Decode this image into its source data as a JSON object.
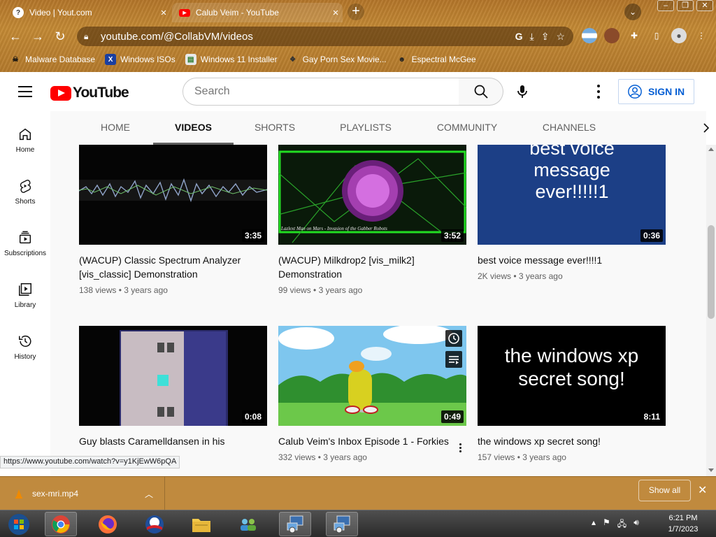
{
  "browser": {
    "tabs": [
      {
        "title": "Video | Yout.com",
        "active": false
      },
      {
        "title": "Calub Veim - YouTube",
        "active": true
      }
    ],
    "new_tab_label": "+",
    "url": "youtube.com/@CollabVM/videos",
    "bookmarks": [
      {
        "label": "Malware Database"
      },
      {
        "label": "Windows ISOs"
      },
      {
        "label": "Windows 11 Installer"
      },
      {
        "label": "Gay Porn Sex Movie..."
      },
      {
        "label": "Espectral McGee"
      }
    ],
    "status_url": "https://www.youtube.com/watch?v=y1KjEwW6pQA"
  },
  "youtube": {
    "logo_text": "YouTube",
    "search_placeholder": "Search",
    "sign_in_label": "SIGN IN",
    "channel_tabs": [
      {
        "label": "HOME"
      },
      {
        "label": "VIDEOS",
        "active": true
      },
      {
        "label": "SHORTS"
      },
      {
        "label": "PLAYLISTS"
      },
      {
        "label": "COMMUNITY"
      },
      {
        "label": "CHANNELS"
      }
    ],
    "guide": [
      {
        "label": "Home",
        "icon": "home-icon"
      },
      {
        "label": "Shorts",
        "icon": "shorts-icon"
      },
      {
        "label": "Subscriptions",
        "icon": "subscriptions-icon"
      },
      {
        "label": "Library",
        "icon": "library-icon"
      },
      {
        "label": "History",
        "icon": "history-icon"
      }
    ],
    "videos": [
      {
        "title": "(WACUP) Classic Spectrum Analyzer [vis_classic] Demonstration",
        "views": "138 views",
        "age": "3 years ago",
        "duration": "3:35"
      },
      {
        "title": "(WACUP) Milkdrop2 [vis_milk2] Demonstration",
        "views": "99 views",
        "age": "3 years ago",
        "duration": "3:52",
        "thumb_caption": "Lazlext Man on Mars - Invasion of the Gabber Robots"
      },
      {
        "title": "best voice message ever!!!!1",
        "views": "2K views",
        "age": "3 years ago",
        "duration": "0:36",
        "thumb_text": "best voice message ever!!!!!1"
      },
      {
        "title": "Guy blasts Caramelldansen in his",
        "views": "",
        "age": "",
        "duration": "0:08"
      },
      {
        "title": "Calub Veim's Inbox Episode 1 - Forkies",
        "views": "332 views",
        "age": "3 years ago",
        "duration": "0:49"
      },
      {
        "title": "the windows xp secret song!",
        "views": "157 views",
        "age": "3 years ago",
        "duration": "8:11",
        "thumb_text": "the windows xp secret song!"
      }
    ]
  },
  "downloads": {
    "filename": "sex-mri.mp4",
    "show_all_label": "Show all"
  },
  "taskbar": {
    "time": "6:21 PM",
    "date": "1/7/2023"
  },
  "colors": {
    "yt_red": "#ff0000",
    "link_blue": "#065fd4",
    "chrome_theme": "#b4762a"
  }
}
